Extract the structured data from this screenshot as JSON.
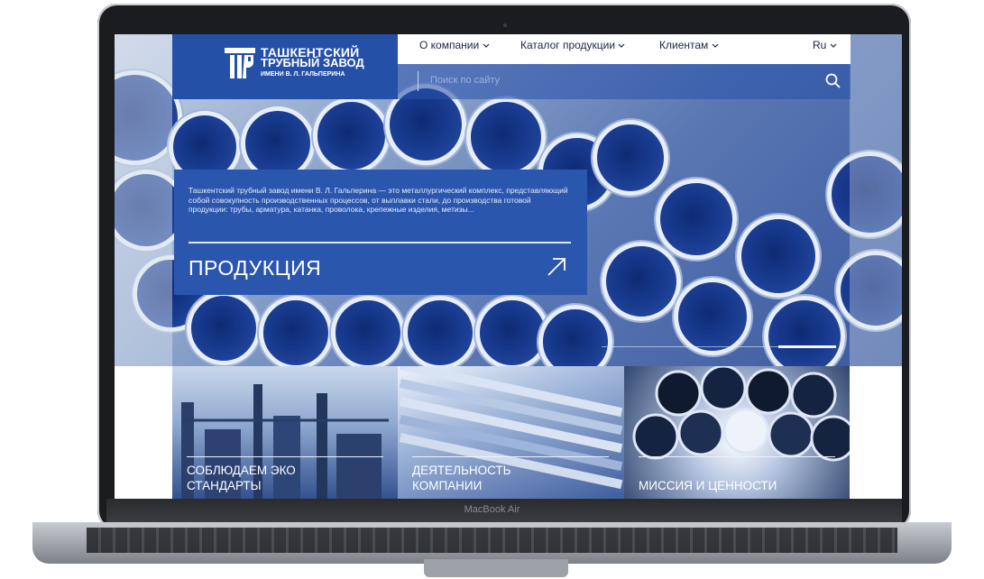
{
  "device": {
    "model_label": "MacBook Air"
  },
  "site": {
    "logo": {
      "line1": "ТАШКЕНТСКИЙ",
      "line2": "ТРУБНЫЙ ЗАВОД",
      "line3": "ИМЕНИ В. Л. ГАЛЬПЕРИНА",
      "icon": "pipe-logo-icon"
    },
    "nav": {
      "items": [
        {
          "label": "О компании",
          "icon": "chevron-down-icon"
        },
        {
          "label": "Каталог продукции",
          "icon": "chevron-down-icon"
        },
        {
          "label": "Клиентам",
          "icon": "chevron-down-icon"
        }
      ],
      "language": {
        "label": "Ru",
        "icon": "chevron-down-icon"
      }
    },
    "search": {
      "placeholder": "Поиск по сайту",
      "icon": "search-icon"
    },
    "promo": {
      "text": "Ташкентский трубный завод имени В. Л. Гальперина — это металлургический комплекс, представляющий собой совокупность производственных процессов, от выплавки стали, до производства готовой продукции: трубы, арматура, катанка, проволока, крепежные изделия, метизы...",
      "title": "ПРОДУКЦИЯ",
      "icon": "arrow-up-right-icon"
    },
    "tiles": [
      {
        "label_line1": "СОБЛЮДАЕМ ЭКО",
        "label_line2": "СТАНДАРТЫ"
      },
      {
        "label_line1": "ДЕЯТЕЛЬНОСТЬ",
        "label_line2": "КОМПАНИИ"
      },
      {
        "label_line1": "МИССИЯ И ЦЕННОСТИ",
        "label_line2": ""
      }
    ],
    "colors": {
      "brand_blue": "#2550a8",
      "nav_text": "#1a2640"
    }
  }
}
